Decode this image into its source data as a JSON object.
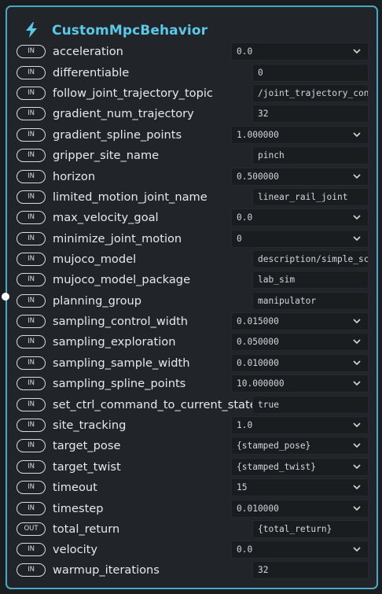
{
  "node": {
    "title": "CustomMpcBehavior",
    "icon": "lightning-bolt-icon",
    "accent": "#4aa8c7"
  },
  "ports": [
    {
      "dir": "IN",
      "name": "acceleration",
      "value": "0.0",
      "kind": "select"
    },
    {
      "dir": "IN",
      "name": "differentiable",
      "value": "0",
      "kind": "text"
    },
    {
      "dir": "IN",
      "name": "follow_joint_trajectory_topic",
      "value": "/joint_trajectory_controller",
      "kind": "text"
    },
    {
      "dir": "IN",
      "name": "gradient_num_trajectory",
      "value": "32",
      "kind": "text"
    },
    {
      "dir": "IN",
      "name": "gradient_spline_points",
      "value": "1.000000",
      "kind": "select"
    },
    {
      "dir": "IN",
      "name": "gripper_site_name",
      "value": "pinch",
      "kind": "text"
    },
    {
      "dir": "IN",
      "name": "horizon",
      "value": "0.500000",
      "kind": "select"
    },
    {
      "dir": "IN",
      "name": "limited_motion_joint_name",
      "value": "linear_rail_joint",
      "kind": "text"
    },
    {
      "dir": "IN",
      "name": "max_velocity_goal",
      "value": "0.0",
      "kind": "select"
    },
    {
      "dir": "IN",
      "name": "minimize_joint_motion",
      "value": "0",
      "kind": "select"
    },
    {
      "dir": "IN",
      "name": "mujoco_model",
      "value": "description/simple_scene.xml",
      "kind": "text"
    },
    {
      "dir": "IN",
      "name": "mujoco_model_package",
      "value": "lab_sim",
      "kind": "text"
    },
    {
      "dir": "IN",
      "name": "planning_group",
      "value": "manipulator",
      "kind": "text"
    },
    {
      "dir": "IN",
      "name": "sampling_control_width",
      "value": "0.015000",
      "kind": "select"
    },
    {
      "dir": "IN",
      "name": "sampling_exploration",
      "value": "0.050000",
      "kind": "select"
    },
    {
      "dir": "IN",
      "name": "sampling_sample_width",
      "value": "0.010000",
      "kind": "select"
    },
    {
      "dir": "IN",
      "name": "sampling_spline_points",
      "value": "10.000000",
      "kind": "select"
    },
    {
      "dir": "IN",
      "name": "set_ctrl_command_to_current_state",
      "value": "true",
      "kind": "text"
    },
    {
      "dir": "IN",
      "name": "site_tracking",
      "value": "1.0",
      "kind": "select"
    },
    {
      "dir": "IN",
      "name": "target_pose",
      "value": "{stamped_pose}",
      "kind": "select"
    },
    {
      "dir": "IN",
      "name": "target_twist",
      "value": "{stamped_twist}",
      "kind": "select"
    },
    {
      "dir": "IN",
      "name": "timeout",
      "value": "15",
      "kind": "select"
    },
    {
      "dir": "IN",
      "name": "timestep",
      "value": "0.010000",
      "kind": "select"
    },
    {
      "dir": "OUT",
      "name": "total_return",
      "value": "{total_return}",
      "kind": "text"
    },
    {
      "dir": "IN",
      "name": "velocity",
      "value": "0.0",
      "kind": "select"
    },
    {
      "dir": "IN",
      "name": "warmup_iterations",
      "value": "32",
      "kind": "text"
    }
  ]
}
